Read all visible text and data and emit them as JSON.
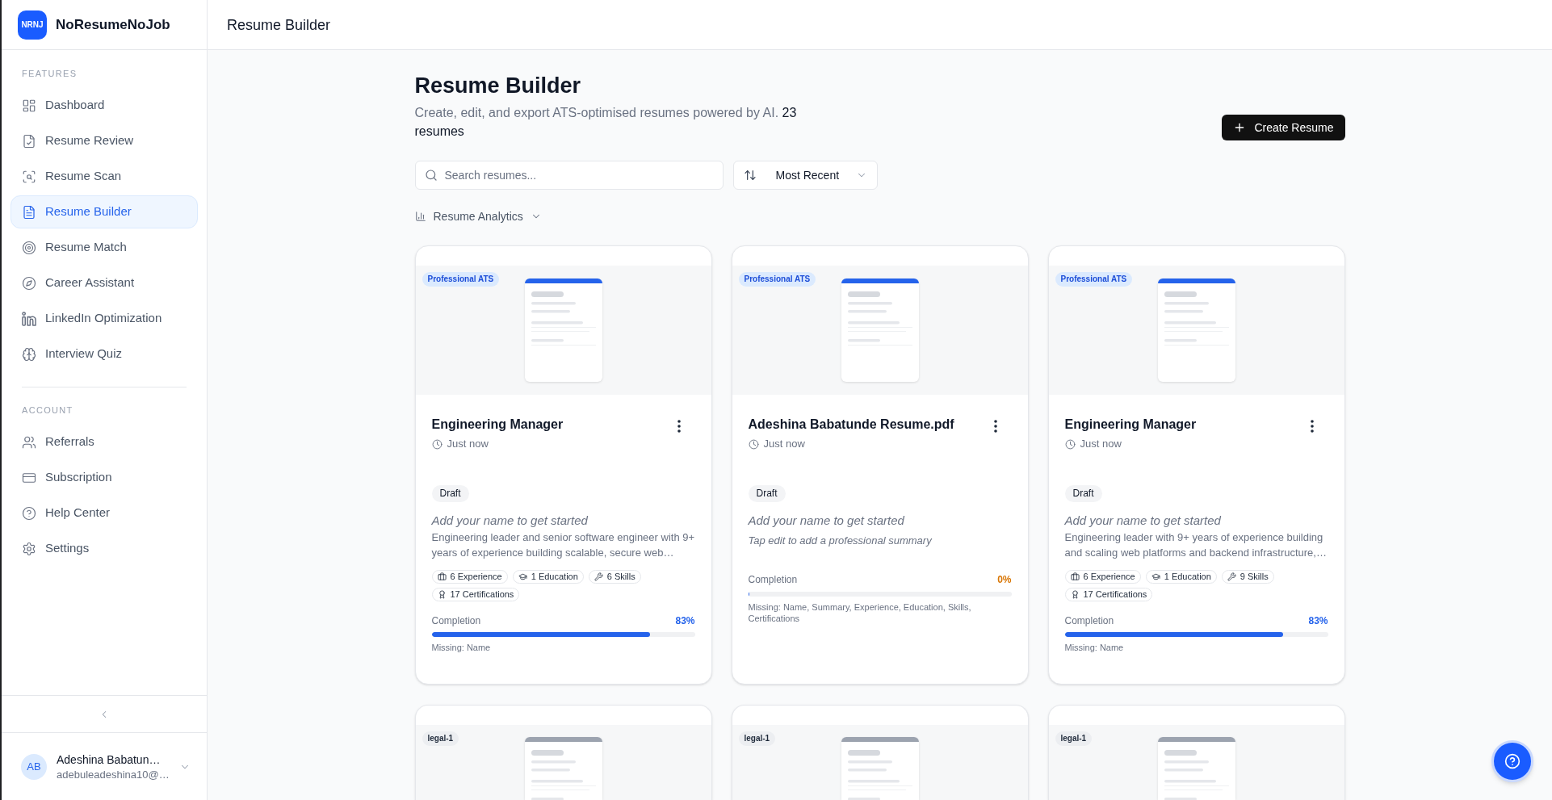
{
  "app": {
    "logo": "NRNJ",
    "name": "NoResumeNoJob"
  },
  "sidebar": {
    "sections": [
      {
        "heading": "FEATURES",
        "items": [
          {
            "label": "Dashboard",
            "selected": false
          },
          {
            "label": "Resume Review",
            "selected": false
          },
          {
            "label": "Resume Scan",
            "selected": false
          },
          {
            "label": "Resume Builder",
            "selected": true
          },
          {
            "label": "Resume Match",
            "selected": false
          },
          {
            "label": "Career Assistant",
            "selected": false
          },
          {
            "label": "LinkedIn Optimization",
            "selected": false
          },
          {
            "label": "Interview Quiz",
            "selected": false
          }
        ]
      },
      {
        "heading": "ACCOUNT",
        "items": [
          {
            "label": "Referrals",
            "selected": false
          },
          {
            "label": "Subscription",
            "selected": false
          },
          {
            "label": "Help Center",
            "selected": false
          },
          {
            "label": "Settings",
            "selected": false
          }
        ]
      }
    ],
    "user": {
      "initials": "AB",
      "name": "Adeshina Babatun…",
      "email": "adebuleadeshina10@…"
    }
  },
  "header": {
    "title": "Resume Builder"
  },
  "page": {
    "title": "Resume Builder",
    "description": "Create, edit, and export ATS-optimised resumes powered by AI. **23 resumes**",
    "create_button": "Create Resume"
  },
  "toolbar": {
    "search": {
      "placeholder": "Search resumes..."
    },
    "sort": {
      "value": "Most Recent"
    },
    "analytics": {
      "label": "Resume Analytics",
      "expanded": false
    }
  },
  "cards": [
    {
      "kind": "professional",
      "template": "Professional ATS",
      "title": "Engineering Manager",
      "updated": "Just now",
      "status": "Draft",
      "name_hint": "Add your name to get started",
      "summary": {
        "kind": "text",
        "text": "Engineering leader and senior software engineer with 9+ years of experience building scalable, secure web…"
      },
      "stats": [
        {
          "kind": "experience",
          "label": "6 Experience"
        },
        {
          "kind": "education",
          "label": "1 Education"
        },
        {
          "kind": "skills",
          "label": "6 Skills"
        },
        {
          "kind": "certifications",
          "label": "17 Certifications"
        }
      ],
      "completion": {
        "label": "Completion",
        "value": "83%",
        "level": 0.83,
        "missing": "Missing: Name"
      }
    },
    {
      "kind": "professional",
      "template": "Professional ATS",
      "title": "Adeshina Babatunde Resume.pdf",
      "updated": "Just now",
      "status": "Draft",
      "name_hint": "Add your name to get started",
      "summary": {
        "kind": "placeholder",
        "text": "Tap edit to add a professional summary"
      },
      "completion": {
        "label": "Completion",
        "value": "0%",
        "level": 0,
        "missing": "Missing: Name, Summary, Experience, Education, Skills, Certifications"
      }
    },
    {
      "kind": "professional",
      "template": "Professional ATS",
      "title": "Engineering Manager",
      "updated": "Just now",
      "status": "Draft",
      "name_hint": "Add your name to get started",
      "summary": {
        "kind": "text",
        "text": "Engineering leader with 9+ years of experience building and scaling web platforms and backend infrastructure,…"
      },
      "stats": [
        {
          "kind": "experience",
          "label": "6 Experience"
        },
        {
          "kind": "education",
          "label": "1 Education"
        },
        {
          "kind": "skills",
          "label": "9 Skills"
        },
        {
          "kind": "certifications",
          "label": "17 Certifications"
        }
      ],
      "completion": {
        "label": "Completion",
        "value": "83%",
        "level": 0.83,
        "missing": "Missing: Name"
      }
    },
    {
      "kind": "legal",
      "template": "legal-1"
    },
    {
      "kind": "legal",
      "template": "legal-1"
    },
    {
      "kind": "legal",
      "template": "legal-1"
    }
  ]
}
